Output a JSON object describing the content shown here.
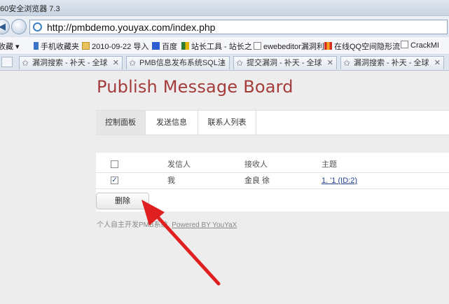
{
  "window": {
    "title": "60安全浏览器 7.3"
  },
  "navbar": {
    "url": "http://pmbdemo.youyax.com/index.php"
  },
  "bookmarks": [
    {
      "label": "收藏",
      "icon": "favorites-star-icon"
    },
    {
      "label": "手机收藏夹",
      "icon": "mobile-icon"
    },
    {
      "label": "2010-09-22 导入",
      "icon": "folder-icon"
    },
    {
      "label": "百度",
      "icon": "baidu-icon"
    },
    {
      "label": "站长工具 - 站长之",
      "icon": "webmaster-icon"
    },
    {
      "label": "ewebeditor漏洞利",
      "icon": "page-icon"
    },
    {
      "label": "在线QQ空间隐形流",
      "icon": "bars-icon"
    },
    {
      "label": "CrackMI",
      "icon": "page-icon"
    }
  ],
  "tabs": [
    {
      "label": "漏洞搜索 - 补天 - 全球",
      "close": "✕"
    },
    {
      "label": "PMB信息发布系统SQL注",
      "close": "✕"
    },
    {
      "label": "提交漏洞 - 补天 - 全球",
      "close": "✕"
    },
    {
      "label": "漏洞搜索 - 补天 - 全球",
      "close": "✕"
    }
  ],
  "app": {
    "title": "Publish Message Board",
    "menu": [
      "控制面板",
      "发送信息",
      "联系人列表"
    ],
    "table": {
      "headers": [
        "发信人",
        "接收人",
        "主题"
      ],
      "rows": [
        {
          "checked": true,
          "sender": "我",
          "receiver": "金良 徐",
          "subject": "1.   '1 (ID:2)"
        }
      ]
    },
    "delete_button": "删除",
    "footer_text": "个人自主开发PMB系统,",
    "footer_link": "Powered BY YouYaX"
  },
  "colors": {
    "brand": "#a53c3c",
    "annotation_arrow": "#e02020",
    "link": "#1f3f8f"
  }
}
